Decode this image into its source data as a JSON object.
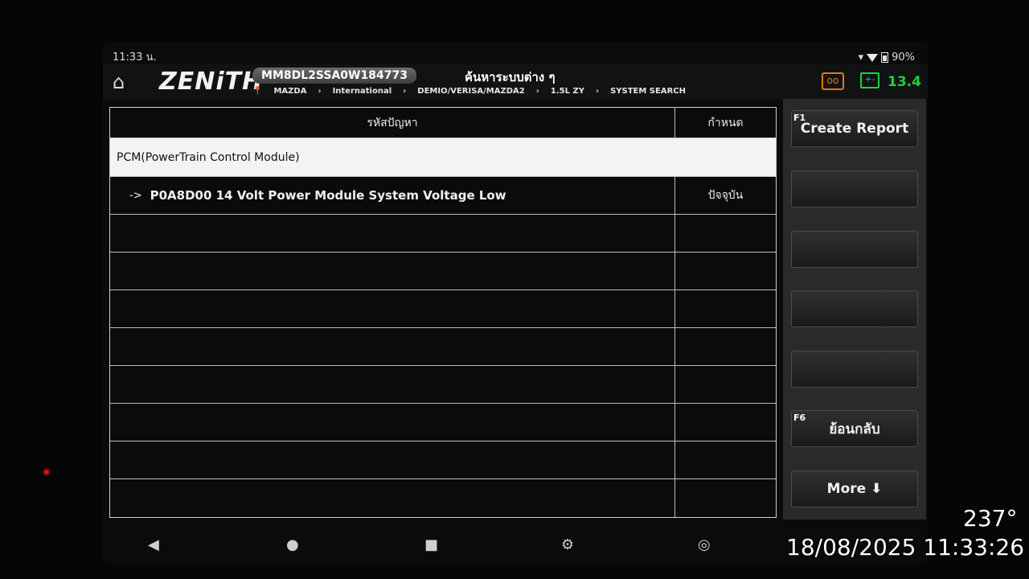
{
  "status": {
    "time": "11:33 น.",
    "battery": "90%"
  },
  "header": {
    "logo": "ZENiTH",
    "vin": "MM8DL2SSA0W184773",
    "title": "ค้นหาระบบต่าง ๆ",
    "breadcrumb": [
      "MAZDA",
      "International",
      "DEMIO/VERISA/MAZDA2",
      "1.5L ZY",
      "SYSTEM SEARCH"
    ],
    "voltage": "13.4",
    "colors": {
      "record": "#e07a10",
      "battery": "#1bd23a"
    }
  },
  "table": {
    "headers": [
      "รหัสปัญหา",
      "กำหนด"
    ],
    "group": "PCM(PowerTrain Control Module)",
    "rows": [
      {
        "code": "P0A8D00 14 Volt Power Module System Voltage Low",
        "status": "ปัจจุบัน"
      }
    ]
  },
  "side": {
    "f1_key": "F1",
    "f1_label": "Create Report",
    "f6_key": "F6",
    "f6_label": "ย้อนกลับ",
    "more_label": "More ⬇"
  },
  "overlay": {
    "heading": "237°",
    "timestamp": "18/08/2025 11:33:26"
  }
}
